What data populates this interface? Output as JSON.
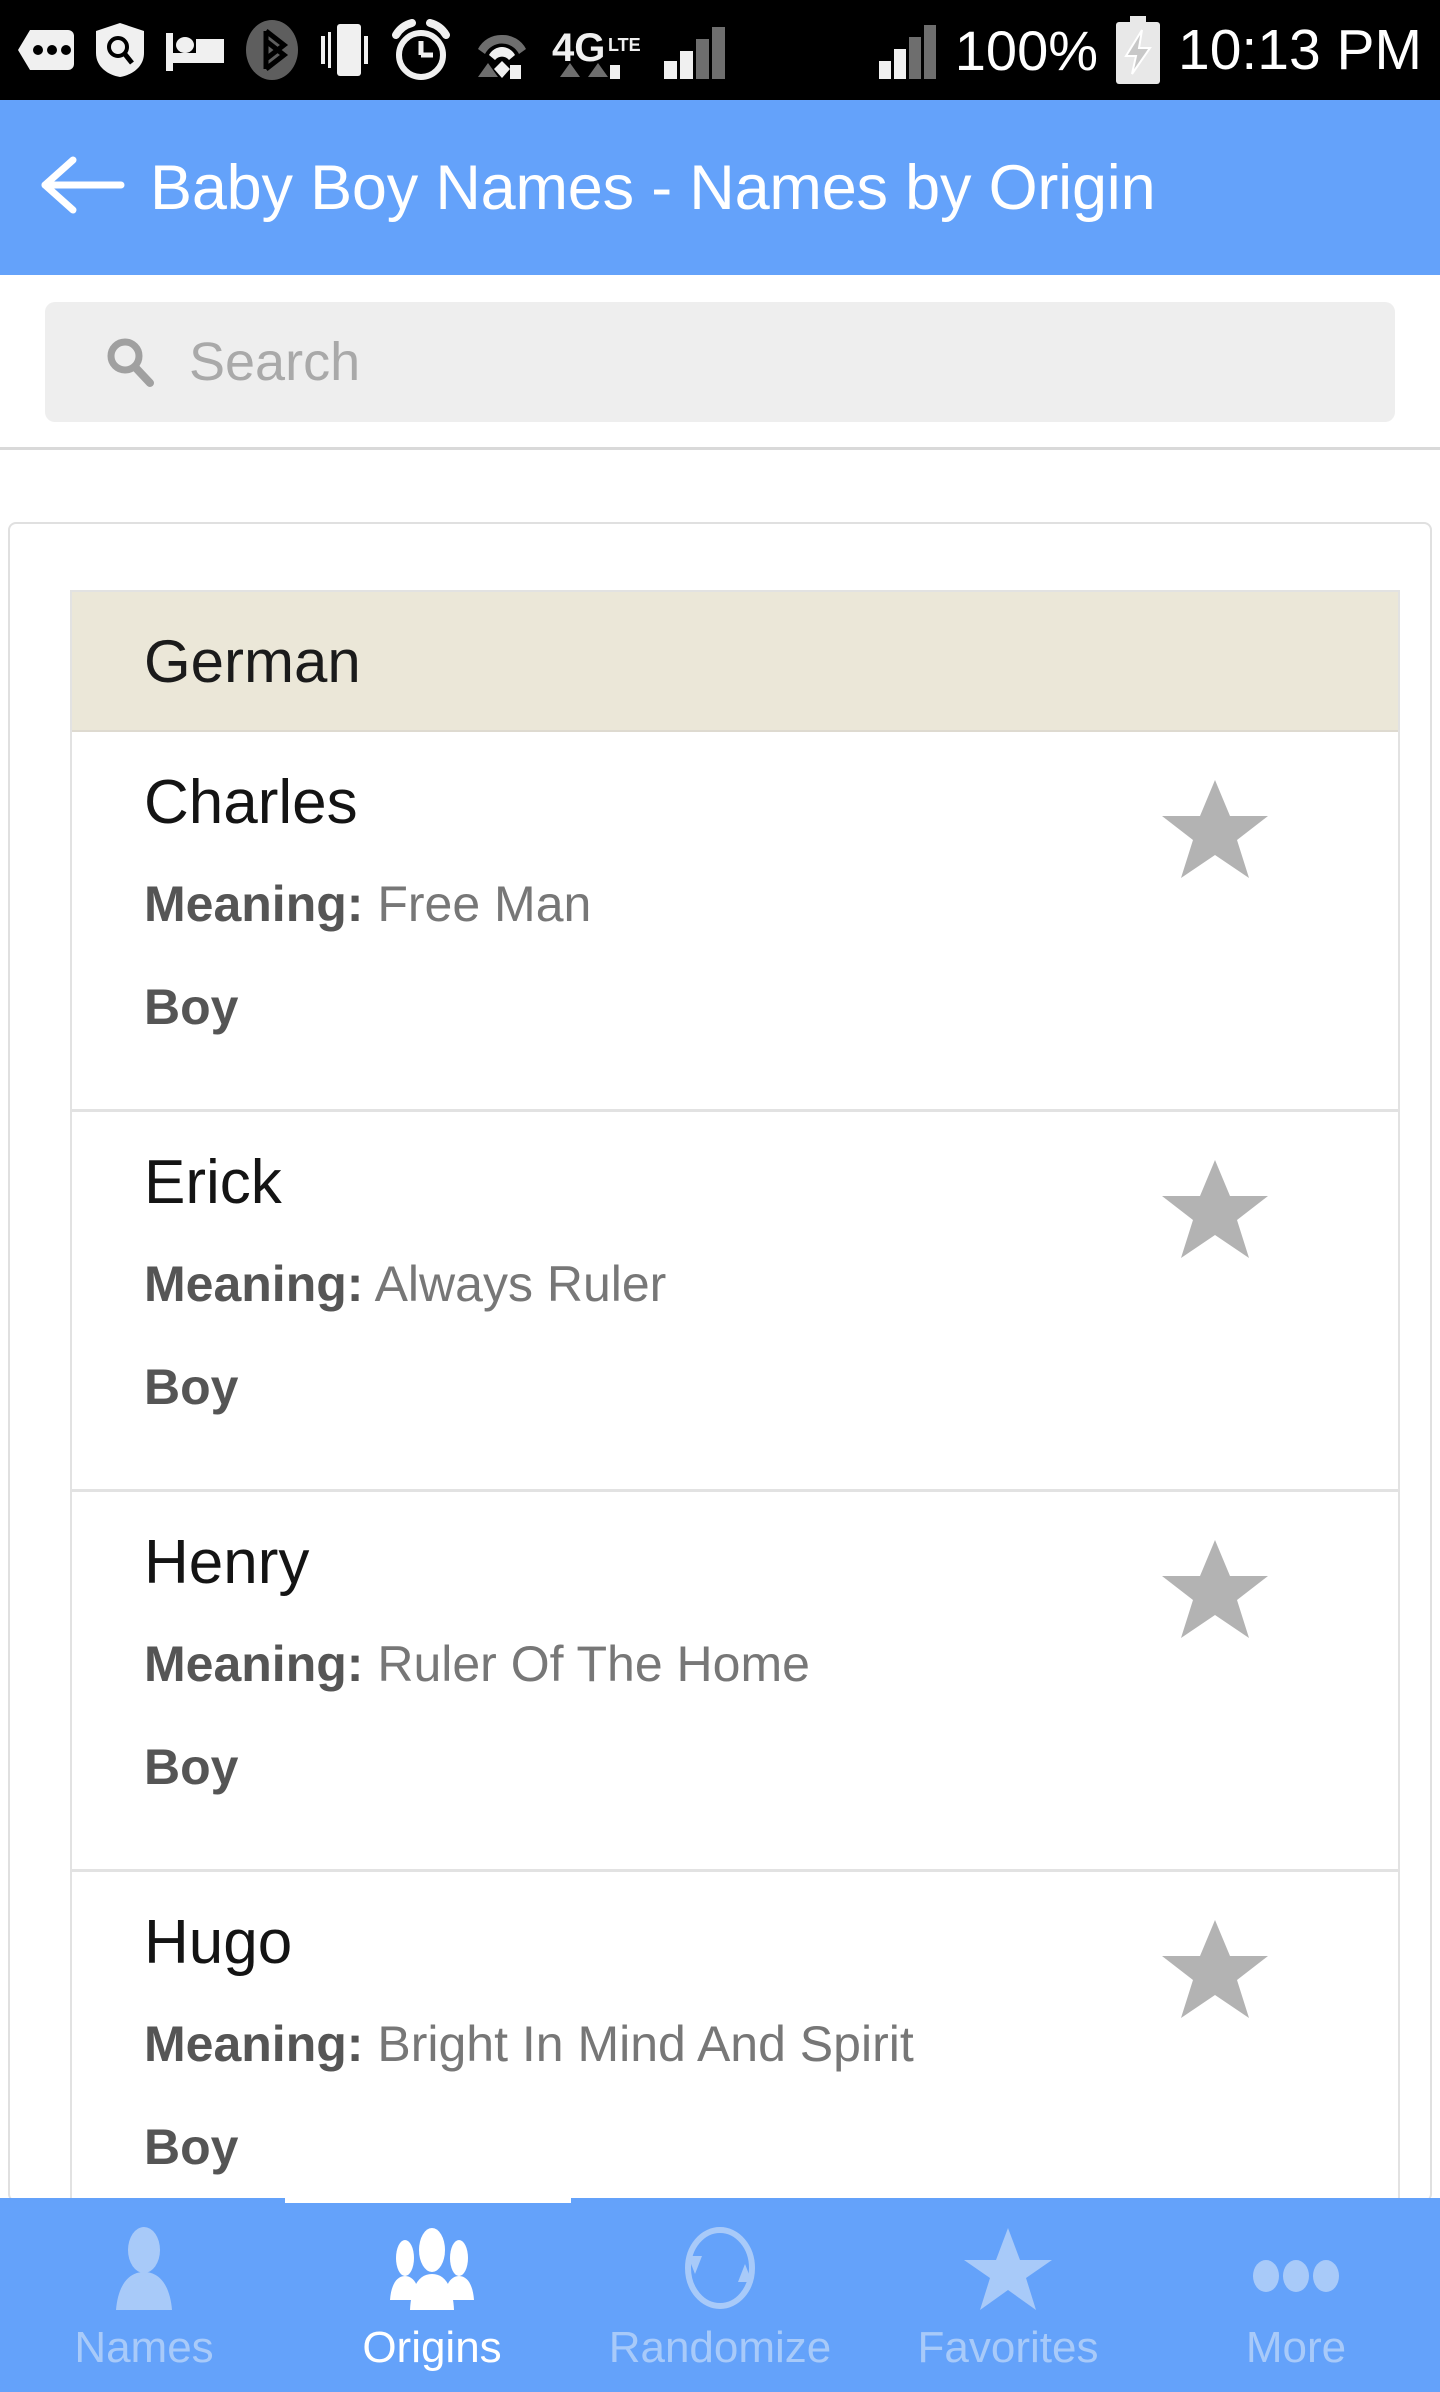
{
  "statusbar": {
    "left_icons": [
      "messages-icon",
      "security-shield-icon",
      "bed-icon",
      "bluetooth-icon",
      "vibrate-icon",
      "alarm-clock-icon",
      "wifi-icon",
      "4g-lte-icon",
      "cellular-signal-icon"
    ],
    "battery_percent": "100%",
    "battery_icon": "battery-charging-icon",
    "time": "10:13 PM"
  },
  "appbar": {
    "back_icon": "back-arrow-icon",
    "title": "Baby Boy Names - Names by Origin",
    "background_color": "#64a2fa",
    "title_color": "#ffffff"
  },
  "search": {
    "icon": "search-icon",
    "placeholder": "Search",
    "value": ""
  },
  "list": {
    "section_header": "German",
    "section_header_color": "#ebe7d8",
    "meaning_label": "Meaning:",
    "star_icon": "star-icon",
    "star_color": "#b3b3b3",
    "items": [
      {
        "name": "Charles",
        "meaning": "Free Man",
        "gender": "Boy"
      },
      {
        "name": "Erick",
        "meaning": "Always Ruler",
        "gender": "Boy"
      },
      {
        "name": "Henry",
        "meaning": "Ruler Of The Home",
        "gender": "Boy"
      },
      {
        "name": "Hugo",
        "meaning": "Bright In Mind And Spirit",
        "gender": "Boy"
      }
    ]
  },
  "bottomnav": {
    "background_color": "#64a2fa",
    "active_color": "#ffffff",
    "inactive_color": "#a8caf9",
    "items": [
      {
        "label": "Names",
        "icon": "person-icon",
        "active": false
      },
      {
        "label": "Origins",
        "icon": "people-icon",
        "active": true
      },
      {
        "label": "Randomize",
        "icon": "refresh-icon",
        "active": false
      },
      {
        "label": "Favorites",
        "icon": "star-icon",
        "active": false
      },
      {
        "label": "More",
        "icon": "more-dots-icon",
        "active": false
      }
    ]
  }
}
